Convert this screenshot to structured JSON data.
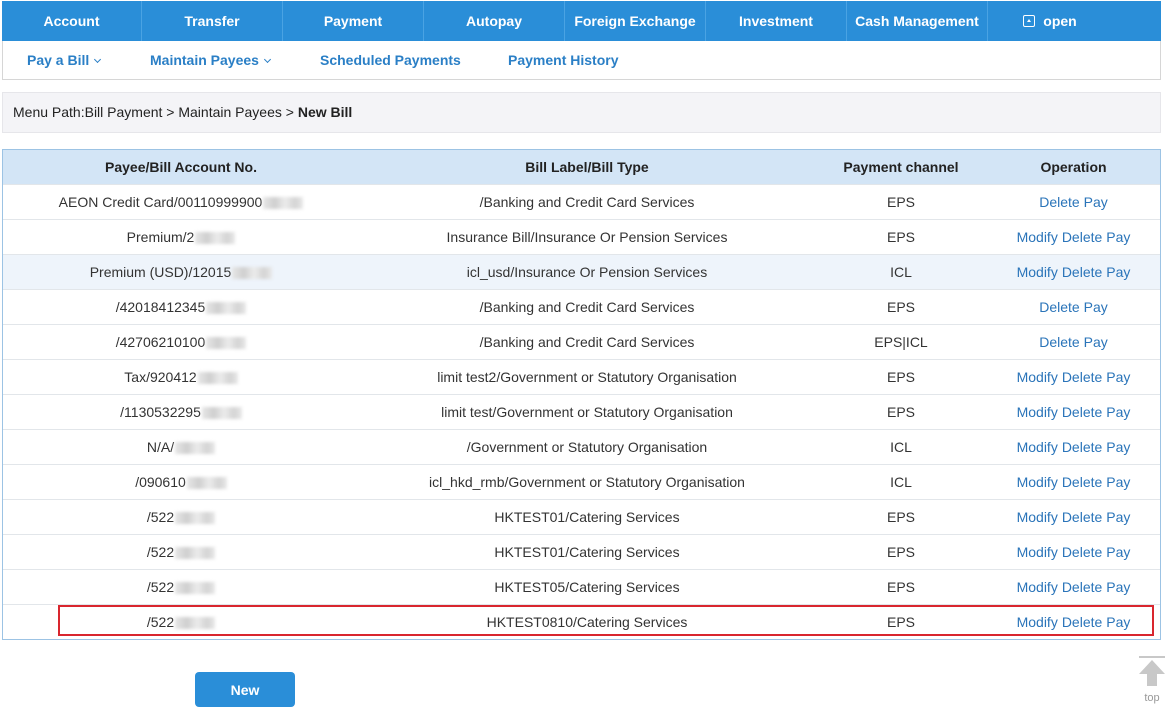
{
  "topnav": {
    "items": [
      "Account",
      "Transfer",
      "Payment",
      "Autopay",
      "Foreign Exchange",
      "Investment",
      "Cash Management"
    ],
    "open_label": "open"
  },
  "subnav": {
    "items": [
      "Pay a Bill",
      "Maintain Payees",
      "Scheduled Payments",
      "Payment History"
    ]
  },
  "breadcrumb": {
    "prefix": "Menu Path:Bill Payment > Maintain Payees > ",
    "current": "New Bill"
  },
  "table": {
    "headers": [
      "Payee/Bill Account No.",
      "Bill Label/Bill Type",
      "Payment channel",
      "Operation"
    ],
    "rows": [
      {
        "account": "AEON Credit Card/00110999900",
        "label": "/Banking and Credit Card Services",
        "channel": "EPS",
        "ops": [
          "Delete",
          "Pay"
        ]
      },
      {
        "account": "Premium/2",
        "label": "Insurance Bill/Insurance Or Pension Services",
        "channel": "EPS",
        "ops": [
          "Modify",
          "Delete",
          "Pay"
        ]
      },
      {
        "account": "Premium (USD)/12015",
        "label": "icl_usd/Insurance Or Pension Services",
        "channel": "ICL",
        "ops": [
          "Modify",
          "Delete",
          "Pay"
        ]
      },
      {
        "account": "/42018412345",
        "label": "/Banking and Credit Card Services",
        "channel": "EPS",
        "ops": [
          "Delete",
          "Pay"
        ]
      },
      {
        "account": "/42706210100",
        "label": "/Banking and Credit Card Services",
        "channel": "EPS|ICL",
        "ops": [
          "Delete",
          "Pay"
        ]
      },
      {
        "account": "Tax/920412",
        "label": "limit test2/Government or Statutory Organisation",
        "channel": "EPS",
        "ops": [
          "Modify",
          "Delete",
          "Pay"
        ]
      },
      {
        "account": "/1130532295",
        "label": "limit test/Government or Statutory Organisation",
        "channel": "EPS",
        "ops": [
          "Modify",
          "Delete",
          "Pay"
        ]
      },
      {
        "account": "N/A/",
        "label": "/Government or Statutory Organisation",
        "channel": "ICL",
        "ops": [
          "Modify",
          "Delete",
          "Pay"
        ]
      },
      {
        "account": "/090610",
        "label": "icl_hkd_rmb/Government or Statutory Organisation",
        "channel": "ICL",
        "ops": [
          "Modify",
          "Delete",
          "Pay"
        ]
      },
      {
        "account": "/522",
        "label": "HKTEST01/Catering Services",
        "channel": "EPS",
        "ops": [
          "Modify",
          "Delete",
          "Pay"
        ]
      },
      {
        "account": "/522",
        "label": "HKTEST01/Catering Services",
        "channel": "EPS",
        "ops": [
          "Modify",
          "Delete",
          "Pay"
        ]
      },
      {
        "account": "/522",
        "label": "HKTEST05/Catering Services",
        "channel": "EPS",
        "ops": [
          "Modify",
          "Delete",
          "Pay"
        ]
      },
      {
        "account": "/522",
        "label": "HKTEST0810/Catering Services",
        "channel": "EPS",
        "ops": [
          "Modify",
          "Delete",
          "Pay"
        ]
      }
    ]
  },
  "new_button": "New",
  "back_to_top": "top"
}
